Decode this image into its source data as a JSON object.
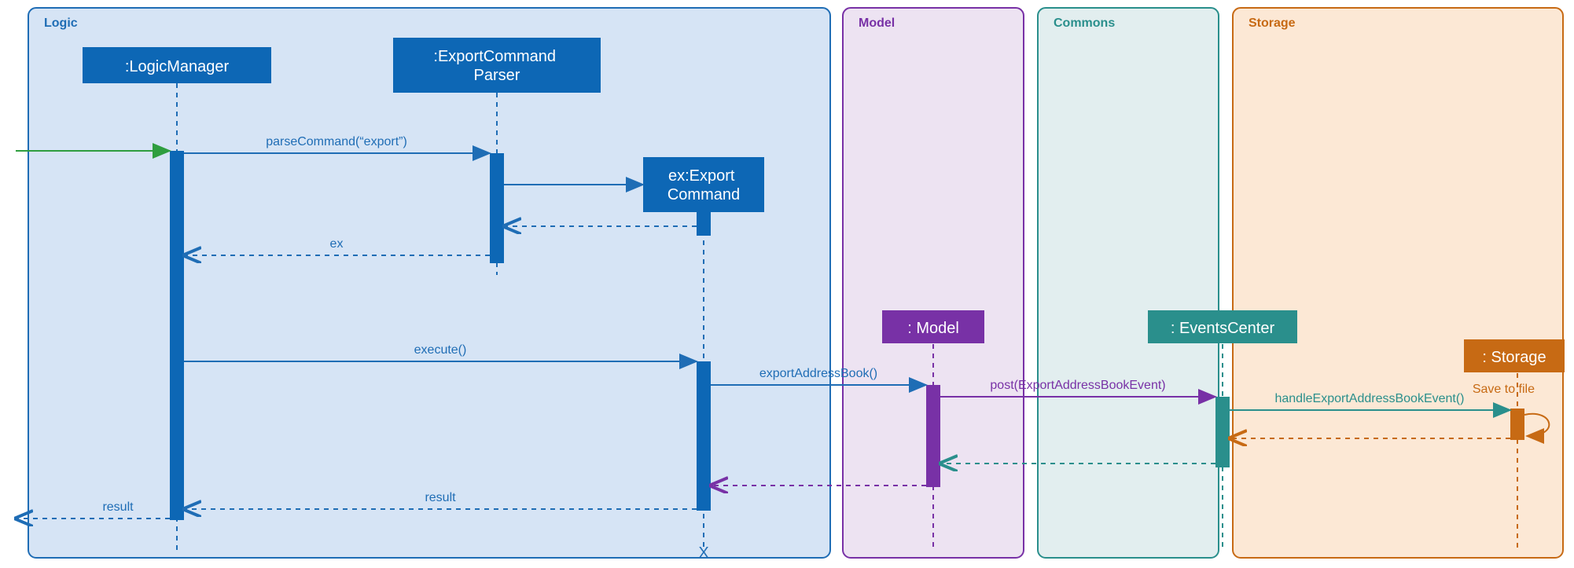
{
  "regions": {
    "logic": {
      "label": "Logic",
      "fill": "#d6e4f5",
      "stroke": "#1f6db5"
    },
    "model": {
      "label": "Model",
      "fill": "#ede3f2",
      "stroke": "#7831a6"
    },
    "commons": {
      "label": "Commons",
      "fill": "#e2eeef",
      "stroke": "#2a8f8c"
    },
    "storage": {
      "label": "Storage",
      "fill": "#fce8d5",
      "stroke": "#c76a14"
    }
  },
  "participants": {
    "logicManager": {
      "label": ":LogicManager",
      "fill": "#0d67b5"
    },
    "exportCommandParser": {
      "label": ":ExportCommand\nParser",
      "fill": "#0d67b5"
    },
    "exportCommand": {
      "label": "ex:Export\nCommand",
      "fill": "#0d67b5"
    },
    "model": {
      "label": ": Model",
      "fill": "#7831a6"
    },
    "eventsCenter": {
      "label": ": EventsCenter",
      "fill": "#2a8f8c"
    },
    "storage": {
      "label": ": Storage",
      "fill": "#c76a14"
    }
  },
  "messages": {
    "parseCommand": {
      "label": "parseCommand(“export”)",
      "color": "#1f6db5"
    },
    "ex": {
      "label": "ex",
      "color": "#1f6db5"
    },
    "execute": {
      "label": "execute()",
      "color": "#1f6db5"
    },
    "exportAddressBook": {
      "label": "exportAddressBook()",
      "color": "#1f6db5"
    },
    "postExportEvent": {
      "label": "post(ExportAddressBookEvent)",
      "color": "#7831a6"
    },
    "handleExportEvent": {
      "label": "handleExportAddressBookEvent()",
      "color": "#2a8f8c"
    },
    "saveToFile": {
      "label": "Save to file",
      "color": "#c76a14"
    },
    "resultInner": {
      "label": "result",
      "color": "#1f6db5"
    },
    "resultOuter": {
      "label": "result",
      "color": "#1f6db5"
    }
  },
  "destroy": {
    "label": "X",
    "color": "#1f6db5"
  }
}
